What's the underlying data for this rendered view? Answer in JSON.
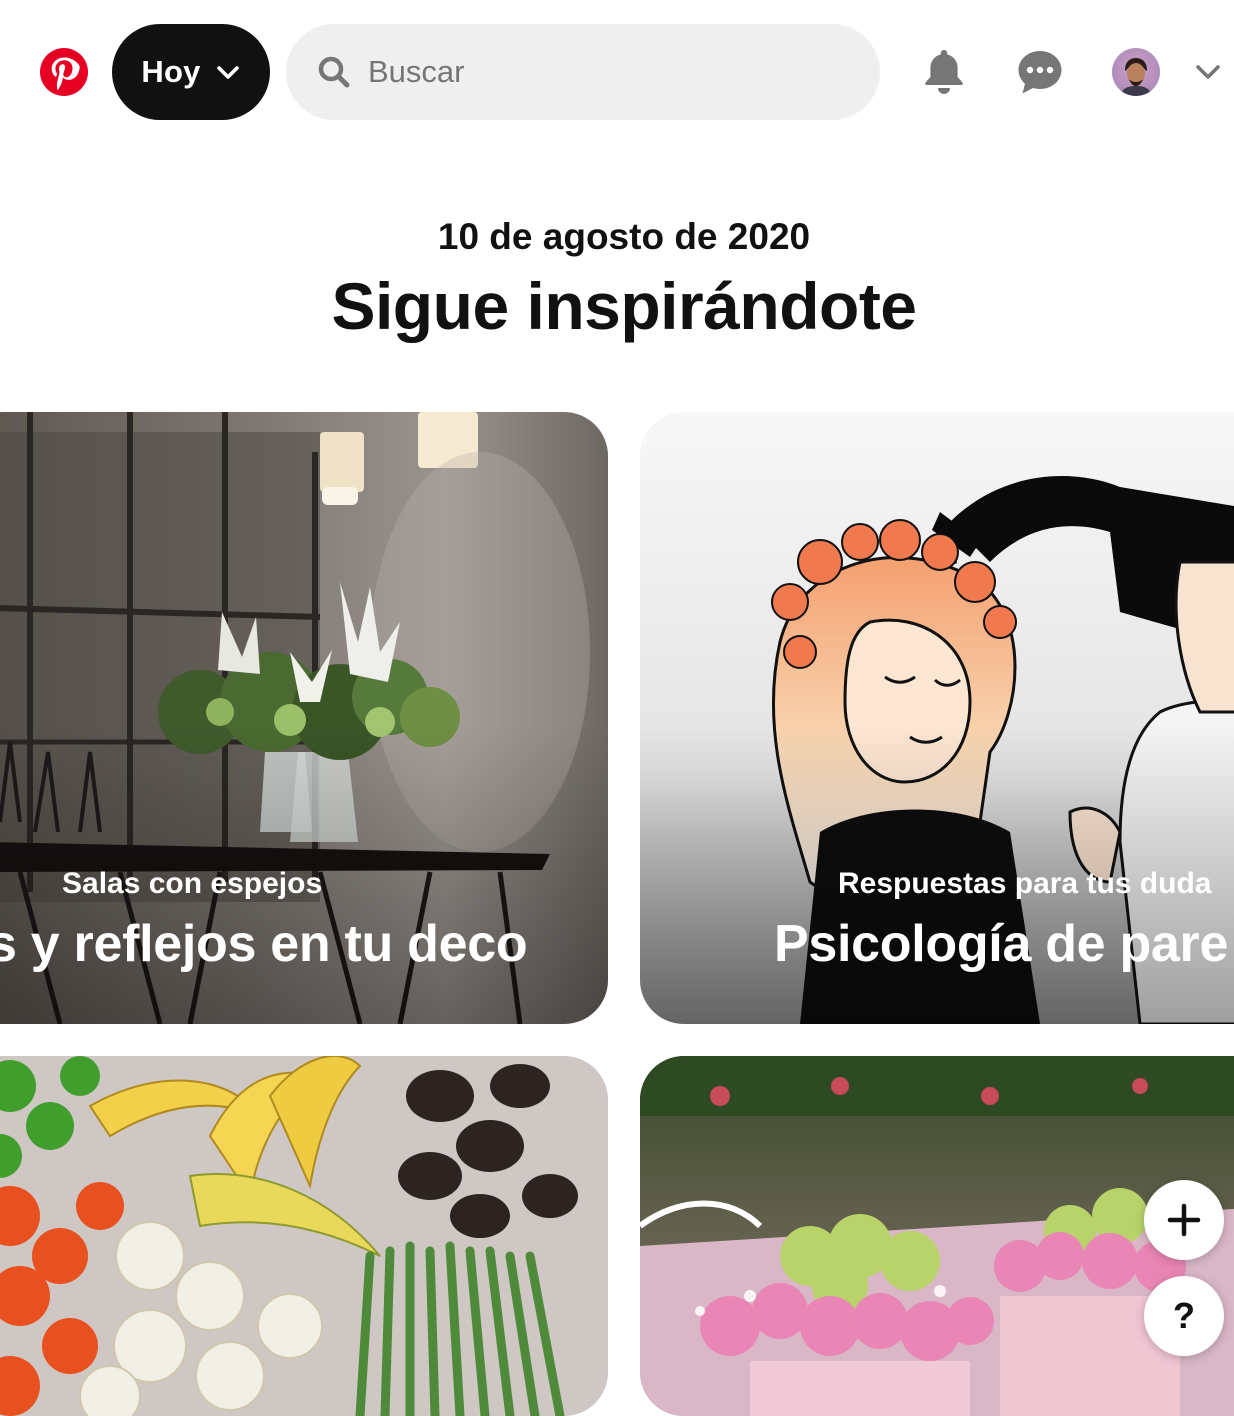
{
  "header": {
    "logo_icon": "pinterest-logo",
    "brand_color": "#e60023",
    "home_menu": {
      "label": "Hoy",
      "icon": "chevron-down-icon"
    },
    "search": {
      "placeholder": "Buscar",
      "value": "",
      "icon": "search-icon"
    },
    "notifications_icon": "bell-icon",
    "messages_icon": "chat-bubble-icon",
    "account_avatar": "avatar",
    "account_menu_icon": "chevron-down-icon"
  },
  "main": {
    "date": "10 de agosto de 2020",
    "title": "Sigue inspirándote",
    "cards": [
      {
        "subtitle": "Salas con espejos",
        "title": "s y reflejos en tu deco"
      },
      {
        "subtitle": "Respuestas para tus duda",
        "title": "Psicología de pare"
      },
      {
        "subtitle": "",
        "title": ""
      },
      {
        "subtitle": "",
        "title": ""
      }
    ]
  },
  "floating": {
    "add_icon": "plus-icon",
    "help_label": "?"
  }
}
